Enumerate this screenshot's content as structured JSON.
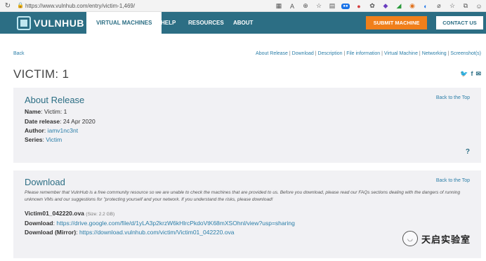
{
  "browser": {
    "url": "https://www.vulnhub.com/entry/victim-1,469/"
  },
  "nav": {
    "logo_text": "VULNHUB",
    "tabs": [
      "VIRTUAL MACHINES",
      "HELP",
      "RESOURCES",
      "ABOUT"
    ],
    "submit_label": "SUBMIT MACHINE",
    "contact_label": "CONTACT US"
  },
  "page": {
    "back_label": "Back",
    "section_links": [
      "About Release",
      "Download",
      "Description",
      "File information",
      "Virtual Machine",
      "Networking",
      "Screenshot(s)"
    ],
    "title": "VICTIM: 1"
  },
  "about": {
    "heading": "About Release",
    "to_top": "Back to the Top",
    "name_label": "Name",
    "name_value": "Victim: 1",
    "date_label": "Date release",
    "date_value": "24 Apr 2020",
    "author_label": "Author",
    "author_value": "iamv1nc3nt",
    "series_label": "Series",
    "series_value": "Victim"
  },
  "download": {
    "heading": "Download",
    "to_top": "Back to the Top",
    "notice": "Please remember that VulnHub is a free community resource so we are unable to check the machines that are provided to us. Before you download, please read our FAQs sections dealing with the dangers of running unknown VMs and our suggestions for \"protecting yourself and your network. If you understand the risks, please download!",
    "file_name": "Victim01_042220.ova",
    "file_size": "(Size: 2.2 GB)",
    "download_label": "Download",
    "download_url": "https://drive.google.com/file/d/1yLA3p2krzW6kHlrcPkdoVtK68mXSOhnl/view?usp=sharing",
    "mirror_label": "Download (Mirror)",
    "mirror_url": "https://download.vulnhub.com/victim/Victim01_042220.ova"
  },
  "watermark": {
    "text": "天启实验室"
  }
}
